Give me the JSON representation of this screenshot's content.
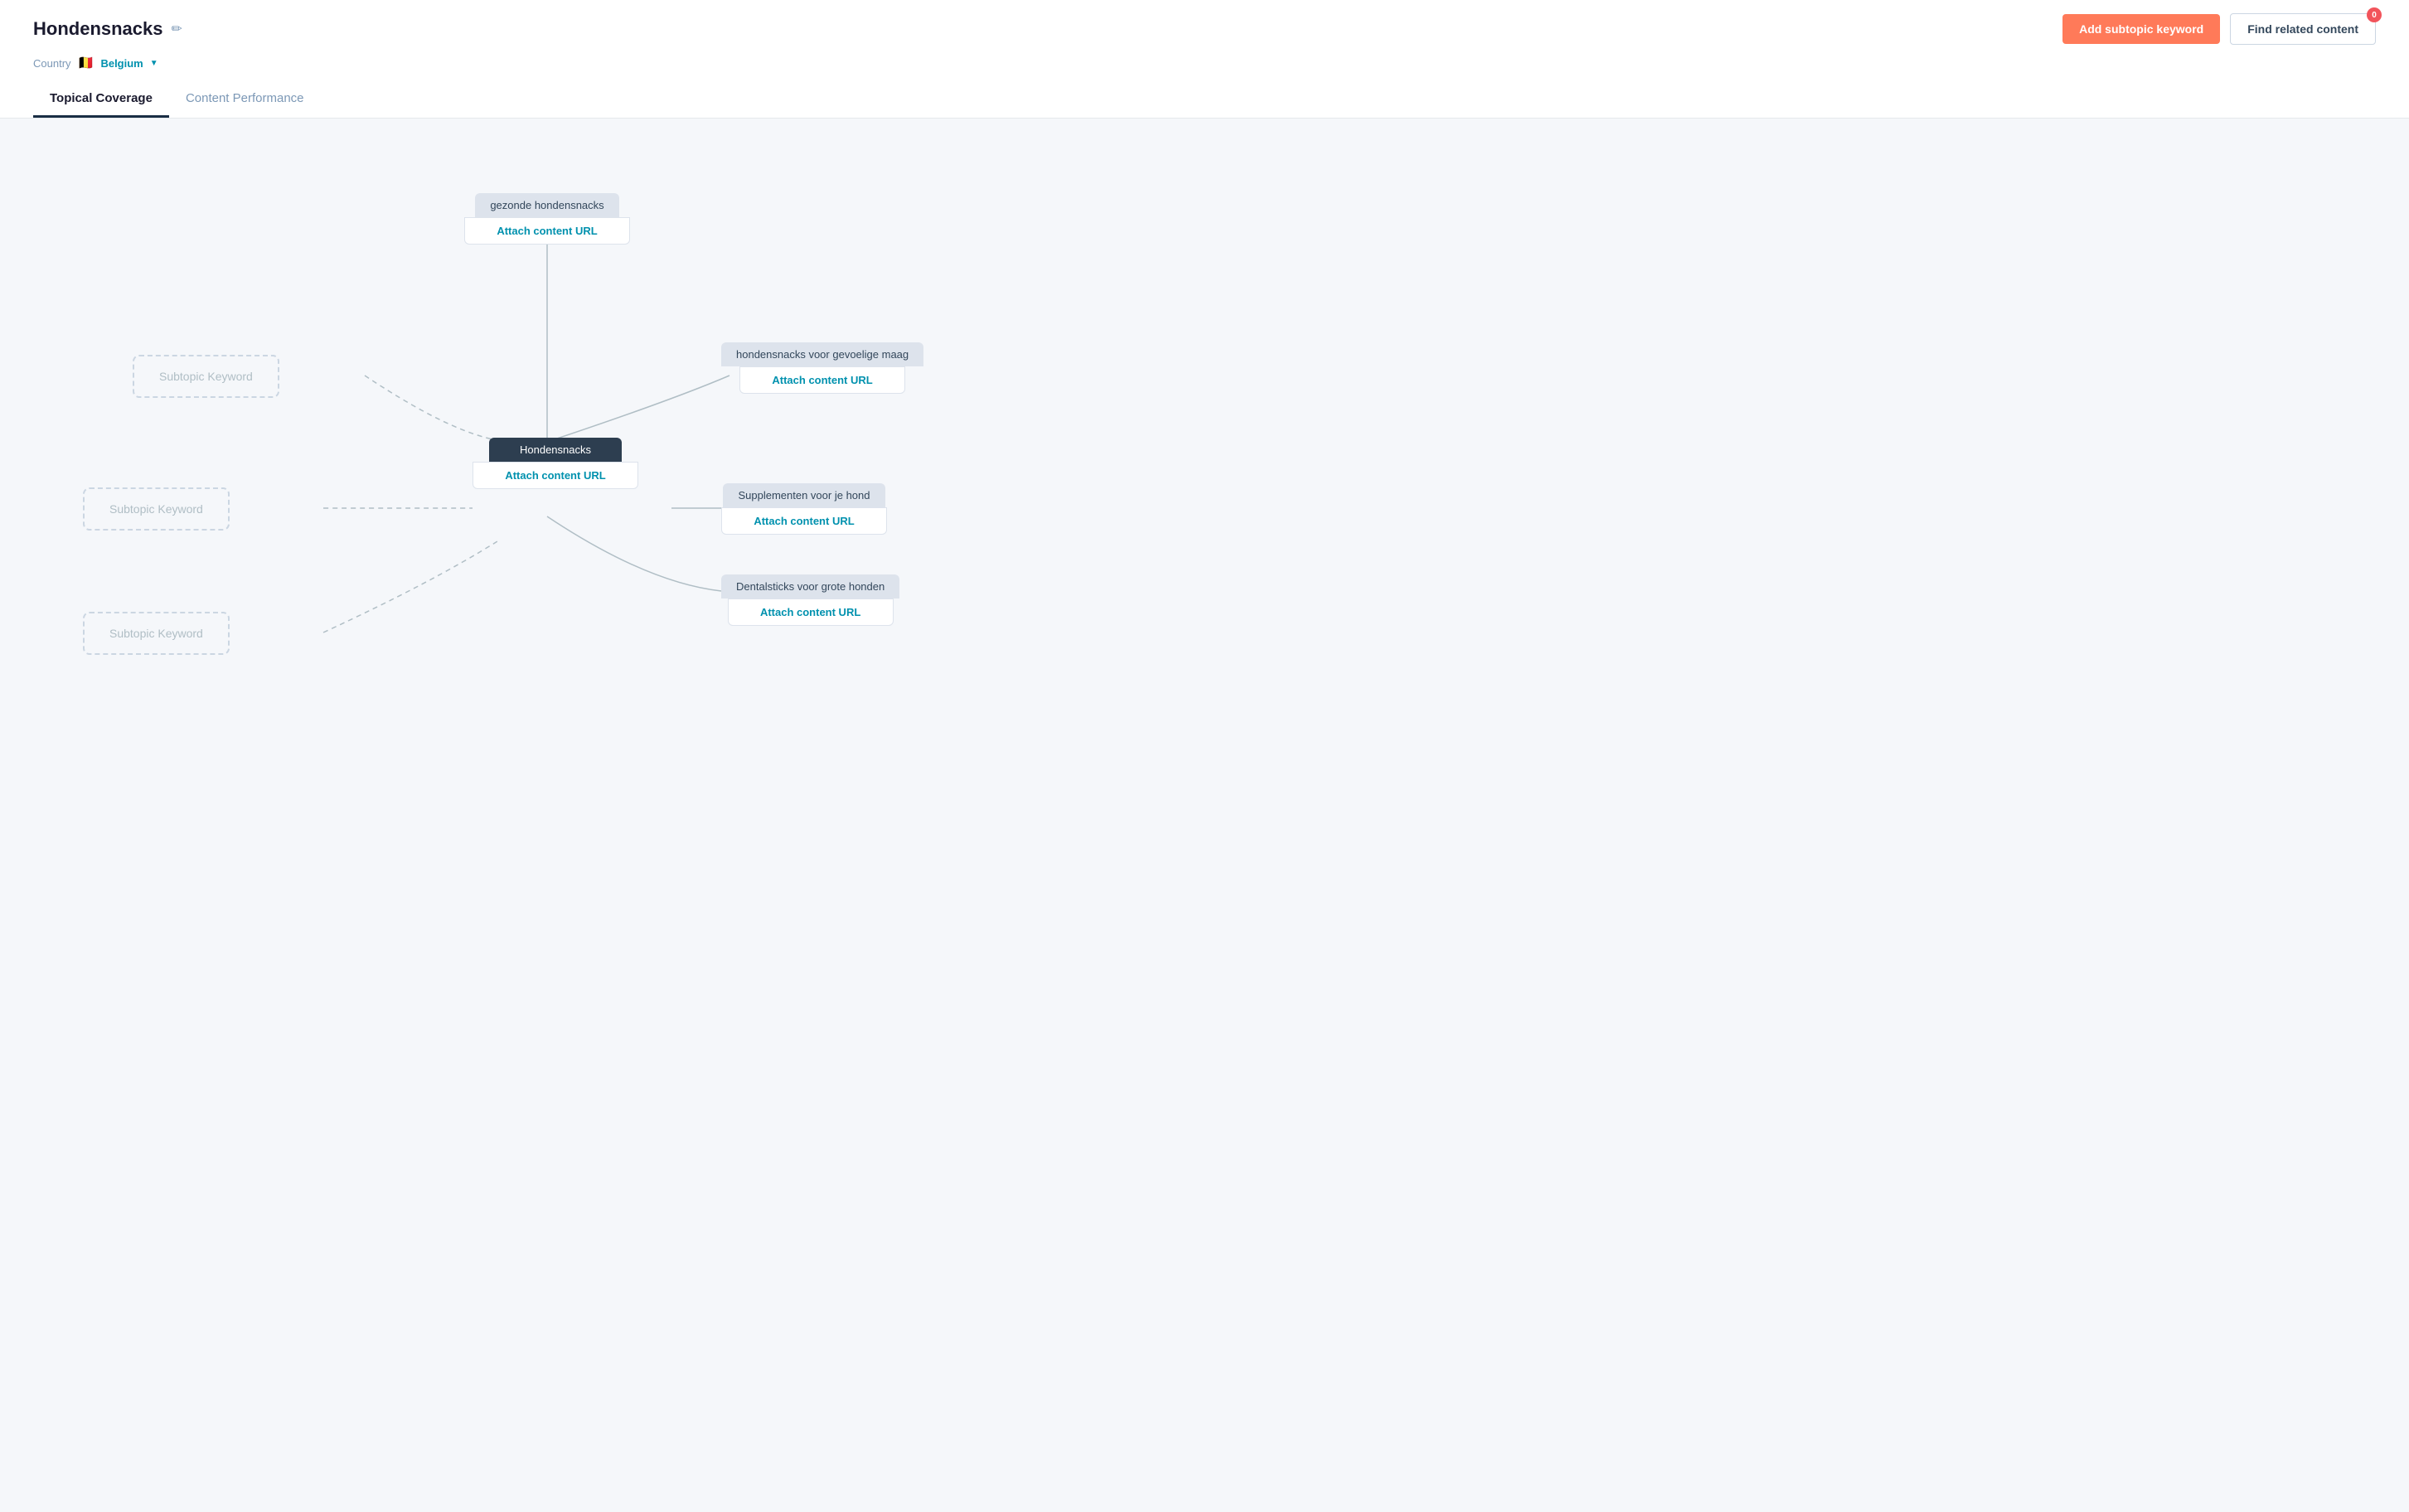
{
  "header": {
    "title": "Hondensnacks",
    "edit_icon": "✏️",
    "country_label": "Country",
    "country_flag": "🇧🇪",
    "country_name": "Belgium",
    "btn_add_subtopic": "Add subtopic keyword",
    "btn_find_related": "Find related content",
    "notification_count": "0"
  },
  "tabs": [
    {
      "id": "topical-coverage",
      "label": "Topical Coverage",
      "active": true
    },
    {
      "id": "content-performance",
      "label": "Content Performance",
      "active": false
    }
  ],
  "nodes": {
    "center": {
      "label": "Hondensnacks",
      "attach_label": "Attach content URL"
    },
    "top": {
      "label": "gezonde hondensnacks",
      "attach_label": "Attach content URL"
    },
    "right_top": {
      "label": "hondensnacks voor gevoelige maag",
      "attach_label": "Attach content URL"
    },
    "right_mid": {
      "label": "Supplementen voor je hond",
      "attach_label": "Attach content URL"
    },
    "right_bottom": {
      "label": "Dentalsticks voor grote honden",
      "attach_label": "Attach content URL"
    }
  },
  "subtopics": [
    {
      "label": "Subtopic Keyword"
    },
    {
      "label": "Subtopic Keyword"
    },
    {
      "label": "Subtopic Keyword"
    }
  ],
  "colors": {
    "accent": "#ff7a59",
    "link": "#0091ae",
    "center_bg": "#2d3e50",
    "node_label_bg": "#dde3ec",
    "subtopic_border": "#cbd6e2"
  }
}
